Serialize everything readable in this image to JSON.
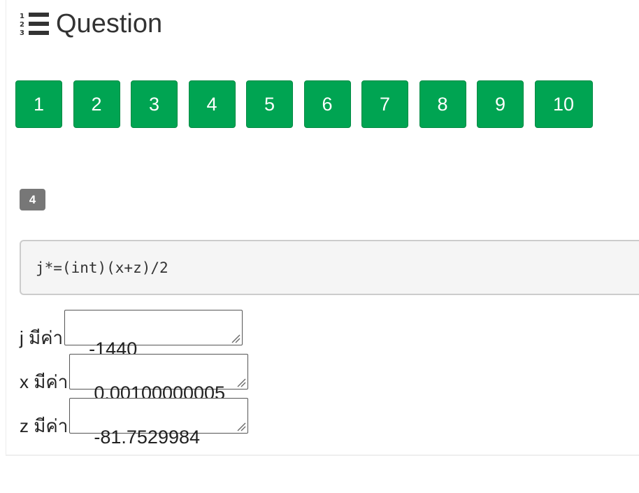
{
  "header": {
    "title": "Question",
    "icon": "list-ol-icon"
  },
  "question_nav": {
    "buttons": [
      "1",
      "2",
      "3",
      "4",
      "5",
      "6",
      "7",
      "8",
      "9",
      "10"
    ],
    "color": "#00a452"
  },
  "question": {
    "number": "4",
    "code": "j*=(int)(x+z)/2"
  },
  "variables": [
    {
      "label": "j มีค่า",
      "value": "-1440"
    },
    {
      "label": "x มีค่า",
      "value": "0.00100000005"
    },
    {
      "label": "z มีค่า",
      "value": "-81.7529984"
    }
  ]
}
